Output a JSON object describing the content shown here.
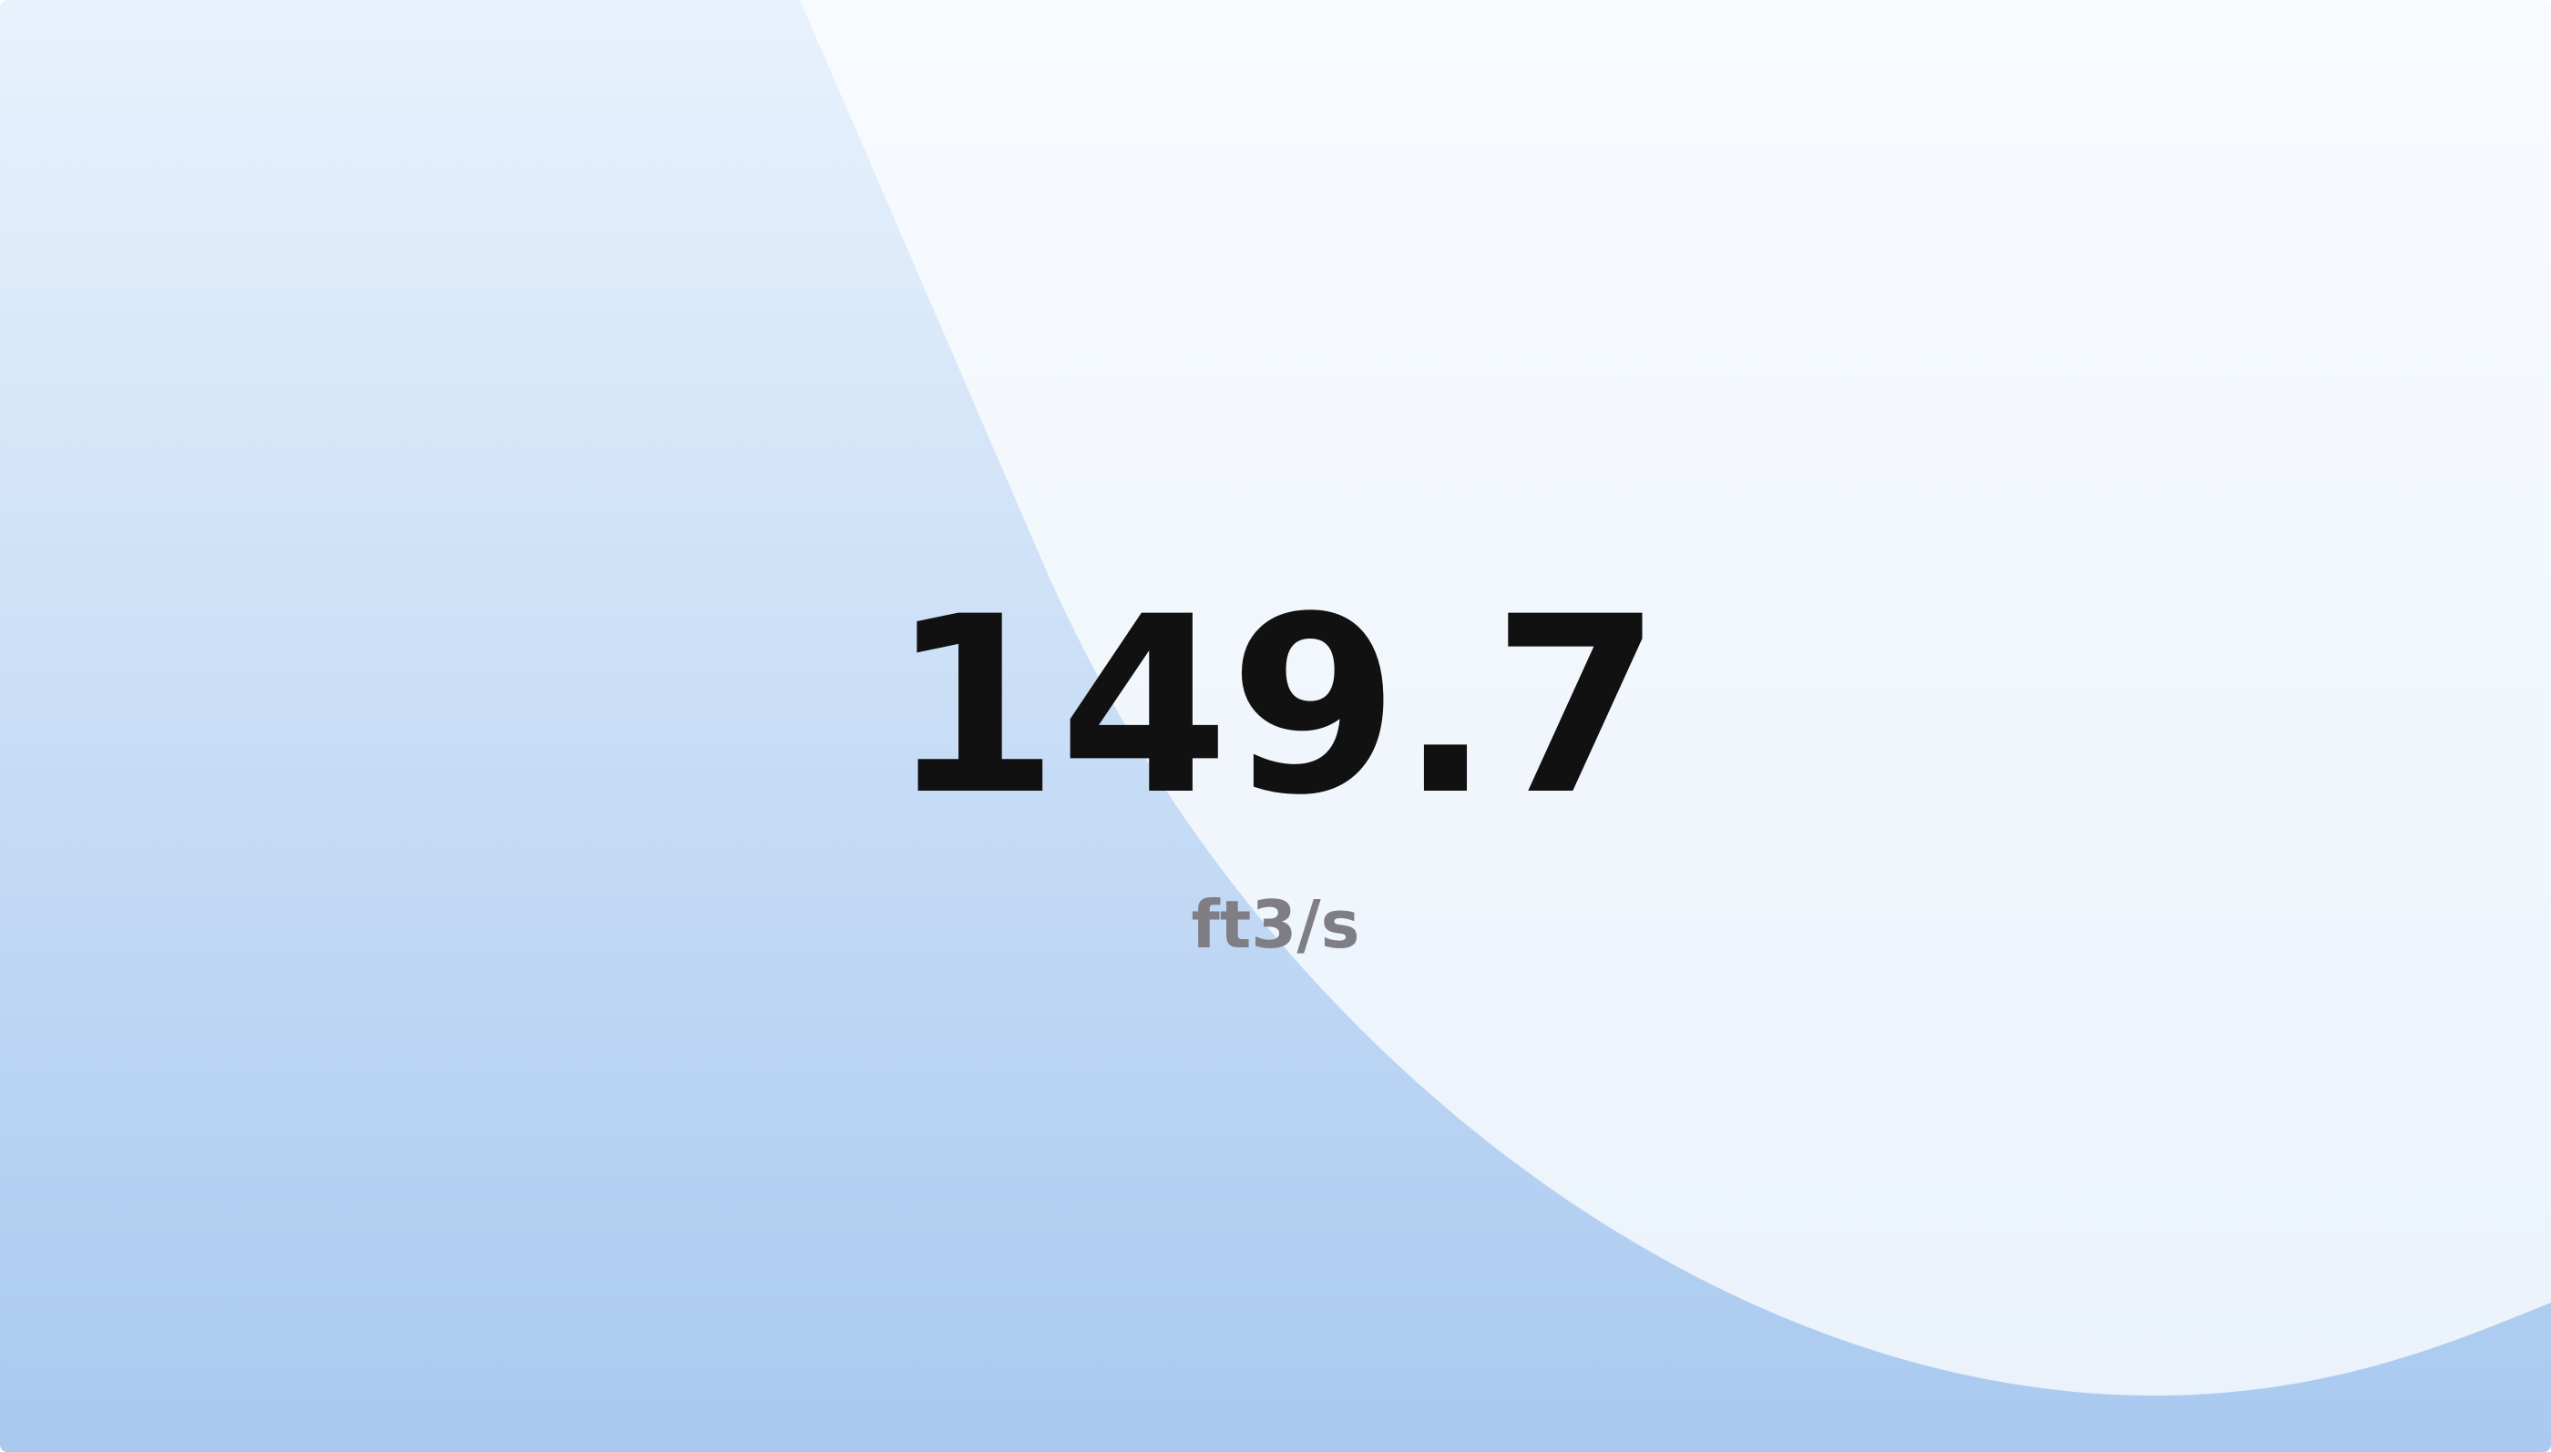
{
  "stat": {
    "value": "149.7",
    "unit": "ft3/s"
  },
  "colors": {
    "fill_top": "#e8f2fd",
    "fill_bottom": "#a9c9ef",
    "background_top": "#f8fbfe",
    "background_bottom": "#eaf2fb",
    "value_text": "#121112",
    "unit_text": "#7e7e84"
  }
}
